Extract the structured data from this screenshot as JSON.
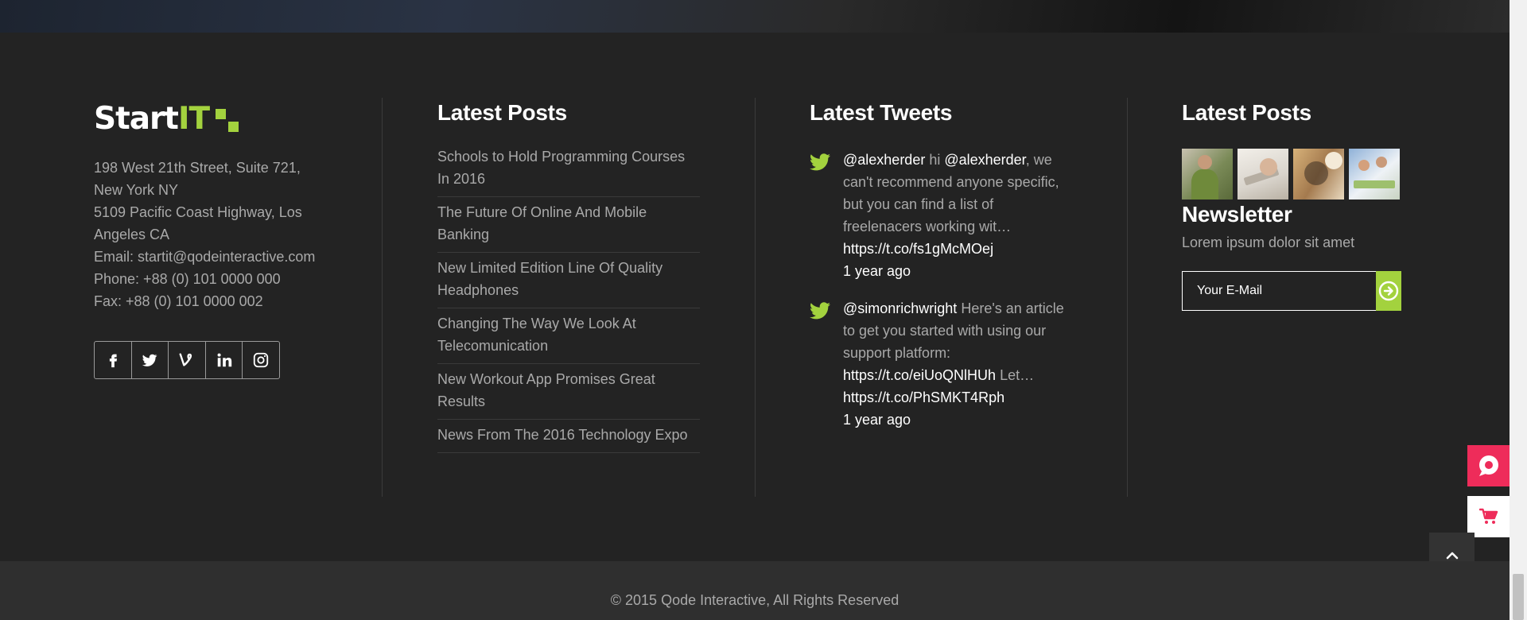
{
  "brand": {
    "logo_main": "Start",
    "logo_accent": "IT",
    "accent_color": "#a3d23e"
  },
  "contact": {
    "lines": [
      "198 West 21th Street, Suite 721,",
      "New York NY",
      "5109 Pacific Coast Highway, Los",
      "Angeles CA",
      "Email: startit@qodeinteractive.com",
      "Phone: +88 (0) 101 0000 000",
      "Fax: +88 (0) 101 0000 002"
    ]
  },
  "social_icons": [
    "facebook-icon",
    "twitter-icon",
    "vine-icon",
    "linkedin-icon",
    "instagram-icon"
  ],
  "latest_posts": {
    "title": "Latest Posts",
    "items": [
      "Schools to Hold Programming Courses In 2016",
      "The Future Of Online And Mobile Banking",
      "New Limited Edition Line Of Quality Headphones",
      "Changing The Way We Look At Telecomunication",
      "New Workout App Promises Great Results",
      "News From The 2016 Technology Expo"
    ]
  },
  "latest_tweets": {
    "title": "Latest Tweets",
    "tweets": [
      {
        "handle": "@alexherder",
        "text1": " hi ",
        "mention": "@alexherder",
        "text2": ", we can't recommend anyone specific, but you can find a list of freelenacers working wit…",
        "link": "https://t.co/fs1gMcMOej",
        "time": "1 year ago"
      },
      {
        "handle": "@simonrichwright",
        "text1": " Here's an article to get you started with using our support platform: ",
        "link": "https://t.co/eiUoQNlHUh",
        "text2": " Let…",
        "link2": "https://t.co/PhSMKT4Rph",
        "time": "1 year ago"
      }
    ]
  },
  "gallery": {
    "title": "Latest Posts"
  },
  "newsletter": {
    "title": "Newsletter",
    "subtitle": "Lorem ipsum dolor sit amet",
    "placeholder": "Your E-Mail"
  },
  "copyright": "© 2015 Qode Interactive, All Rights Reserved",
  "colors": {
    "footer_bg": "#232323",
    "bottom_bg": "#2f2f2f",
    "float_pink": "#ee2c5a"
  }
}
